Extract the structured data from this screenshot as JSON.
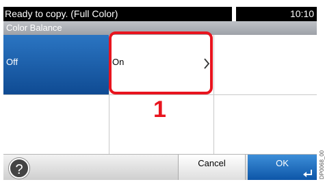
{
  "status_bar": {
    "message": "Ready to copy. (Full Color)",
    "time": "10:10"
  },
  "title": "Color Balance",
  "options": [
    {
      "label": "Off",
      "selected": true
    },
    {
      "label": "On",
      "selected": false
    }
  ],
  "annotation": {
    "number": "1",
    "color": "#e8141e"
  },
  "buttons": {
    "cancel": "Cancel",
    "ok": "OK",
    "help": "?"
  },
  "side_code": "DP0068_00",
  "colors": {
    "selected_bg": "#1f62ae",
    "accent_red": "#e8141e"
  }
}
